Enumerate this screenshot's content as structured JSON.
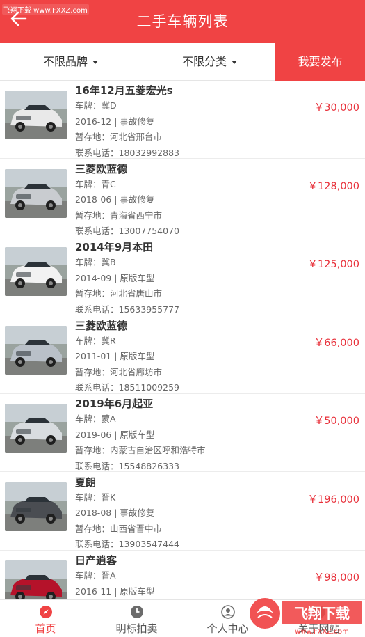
{
  "watermark": "飞翔下载 www.FXXZ.com",
  "header": {
    "title": "二手车辆列表"
  },
  "filters": {
    "brand": "不限品牌",
    "category": "不限分类",
    "publish": "我要发布"
  },
  "labels": {
    "plate": "车牌：",
    "location": "暂存地：",
    "phone": "联系电话："
  },
  "cars": [
    {
      "name": "16年12月五菱宏光s",
      "plate": "冀D",
      "date": "2016-12",
      "condition": "事故修复",
      "location": "河北省邢台市",
      "phone": "18032992883",
      "price": "￥30,000",
      "color": "#e9e9e9"
    },
    {
      "name": "三菱欧蓝德",
      "plate": "青C",
      "date": "2018-06",
      "condition": "事故修复",
      "location": "青海省西宁市",
      "phone": "13007754070",
      "price": "￥128,000",
      "color": "#c9ccd0"
    },
    {
      "name": "2014年9月本田",
      "plate": "冀B",
      "date": "2014-09",
      "condition": "原版车型",
      "location": "河北省唐山市",
      "phone": "15633955777",
      "price": "￥125,000",
      "color": "#f2f2f2"
    },
    {
      "name": "三菱欧蓝德",
      "plate": "冀R",
      "date": "2011-01",
      "condition": "原版车型",
      "location": "河北省廊坊市",
      "phone": "18511009259",
      "price": "￥66,000",
      "color": "#b9c0c8"
    },
    {
      "name": "2019年6月起亚",
      "plate": "蒙A",
      "date": "2019-06",
      "condition": "原版车型",
      "location": "内蒙古自治区呼和浩特市",
      "phone": "15548826333",
      "price": "￥50,000",
      "color": "#d8dcdf"
    },
    {
      "name": "夏朗",
      "plate": "晋K",
      "date": "2018-08",
      "condition": "事故修复",
      "location": "山西省晋中市",
      "phone": "13903547444",
      "price": "￥196,000",
      "color": "#4a4d52"
    },
    {
      "name": "日产逍客",
      "plate": "晋A",
      "date": "2016-11",
      "condition": "原版车型",
      "location": "",
      "phone": "",
      "price": "￥98,000",
      "color": "#b5122a"
    }
  ],
  "tabs": [
    {
      "label": "首页",
      "icon": "compass-icon"
    },
    {
      "label": "明标拍卖",
      "icon": "clock-icon"
    },
    {
      "label": "个人中心",
      "icon": "user-icon"
    },
    {
      "label": "关于网站",
      "icon": "info-icon"
    }
  ],
  "badge": {
    "text": "飞翔下载",
    "sub": "www.FXXZ.com"
  },
  "colors": {
    "primary": "#f04344",
    "price": "#e8303a"
  }
}
